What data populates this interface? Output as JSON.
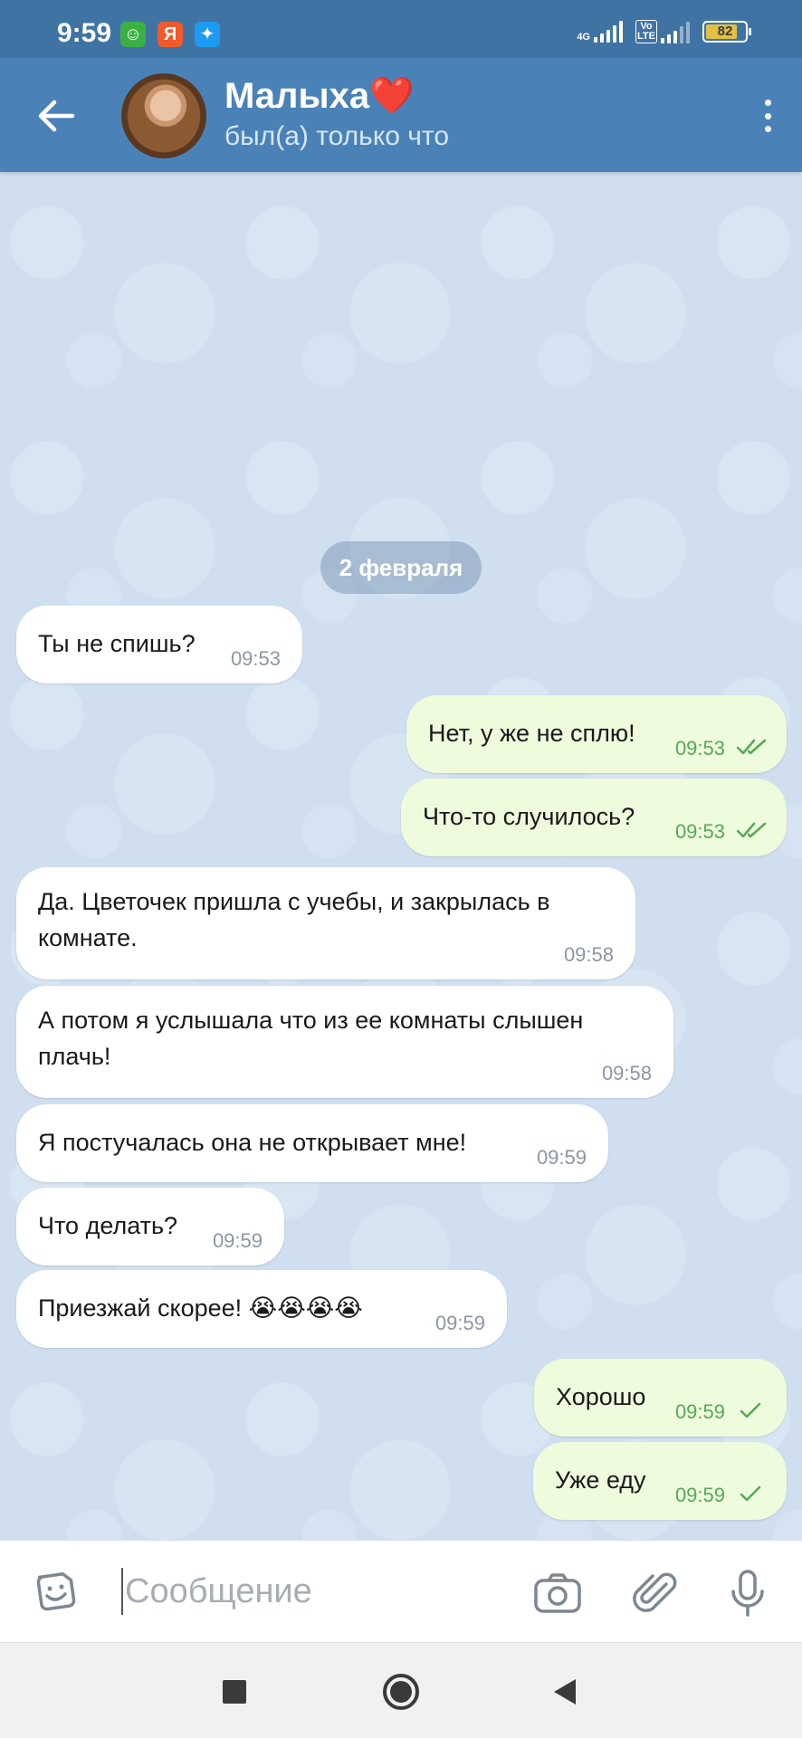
{
  "status_bar": {
    "time": "9:59",
    "apps": [
      {
        "name": "robot-app-icon",
        "glyph": "☺",
        "color": "#3cb043"
      },
      {
        "name": "yandex-app-icon",
        "glyph": "Я",
        "color": "#f25a2b"
      },
      {
        "name": "twitter-app-icon",
        "glyph": "✦",
        "color": "#1d9bf0"
      }
    ],
    "network1": "4G",
    "network2": "Vo LTE",
    "battery": "82"
  },
  "header": {
    "contact_name": "Малыха❤️",
    "contact_status": "был(а) только что",
    "icons": {
      "back": "arrow-left-icon",
      "menu": "more-vertical-icon"
    }
  },
  "chat": {
    "date_chip": "2 февраля",
    "messages": [
      {
        "dir": "in",
        "text": "Ты не спишь?",
        "time": "09:53"
      },
      {
        "dir": "out",
        "text": "Нет, у же не сплю!",
        "time": "09:53",
        "status": "read"
      },
      {
        "dir": "out",
        "text": "Что-то случилось?",
        "time": "09:53",
        "status": "read"
      },
      {
        "dir": "in",
        "text": "Да. Цветочек пришла с учебы, и закрылась в комнате.",
        "time": "09:58"
      },
      {
        "dir": "in",
        "text": "А потом я услышала что из ее комнаты слышен плачь!",
        "time": "09:58"
      },
      {
        "dir": "in",
        "text": "Я постучалась она не открывает мне!",
        "time": "09:59"
      },
      {
        "dir": "in",
        "text": "Что делать?",
        "time": "09:59"
      },
      {
        "dir": "in",
        "text": "Приезжай скорее! 😭😭😭😭",
        "time": "09:59"
      },
      {
        "dir": "out",
        "text": "Хорошо",
        "time": "09:59",
        "status": "sent"
      },
      {
        "dir": "out",
        "text": "Уже еду",
        "time": "09:59",
        "status": "sent"
      }
    ]
  },
  "input_bar": {
    "placeholder": "Сообщение",
    "icons": {
      "emoji": "sticker-smile-icon",
      "camera": "camera-icon",
      "attach": "paperclip-icon",
      "mic": "microphone-icon"
    }
  },
  "nav_bar": {
    "icons": [
      "recents-square-icon",
      "home-circle-icon",
      "back-triangle-icon"
    ]
  },
  "colors": {
    "header": "#4a82b8",
    "status_bar": "#3f73a4",
    "chat_bg": "#d0dff0",
    "incoming_bubble": "#ffffff",
    "outgoing_bubble": "#eefbdd",
    "outgoing_meta": "#57a957"
  }
}
